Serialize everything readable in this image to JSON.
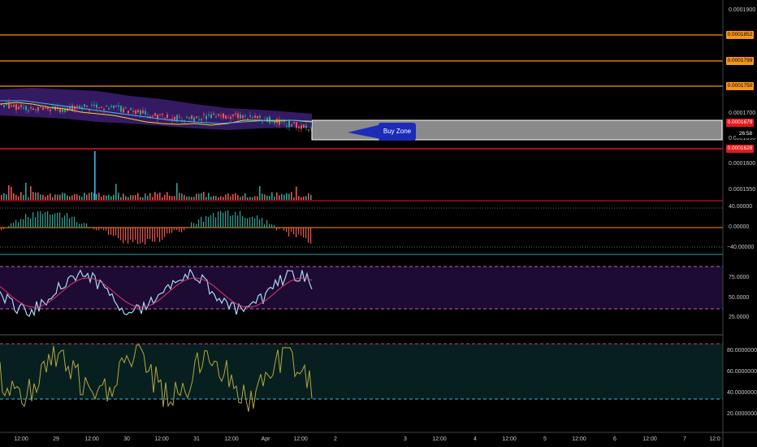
{
  "price_axis": {
    "labels": [
      "0.0001900",
      "0.0001700",
      "0.0001650",
      "0.0001600",
      "0.0001550"
    ],
    "tags": [
      {
        "value": "0.0001852",
        "color": "#f7941d"
      },
      {
        "value": "0.0001799",
        "color": "#f7941d"
      },
      {
        "value": "0.0001750",
        "color": "#f7941d"
      },
      {
        "value": "0.0001679",
        "color": "#e3191b"
      },
      {
        "value": "0.0001628",
        "color": "#e3191b"
      }
    ],
    "countdown": "26:58"
  },
  "annotation": {
    "label": "Buy Zone"
  },
  "indicator_axes": {
    "macd": [
      "40.00000",
      "0.00000",
      "−40.00000"
    ],
    "rsi": [
      "75.0000",
      "50.0000",
      "25.0000"
    ],
    "stoch": [
      "80.0000000",
      "60.0000000",
      "40.0000000",
      "20.0000000"
    ]
  },
  "time_axis": {
    "labels": [
      "12:00",
      "29",
      "12:00",
      "30",
      "12:00",
      "31",
      "12:00",
      "Apr",
      "12:00",
      "2",
      "3",
      "12:00",
      "4",
      "12:00",
      "5",
      "12:00",
      "6",
      "12:00",
      "7",
      "12:0"
    ]
  },
  "colors": {
    "up": "#26a69a",
    "down": "#ef5350",
    "orange": "#f7941d",
    "red": "#e3191b",
    "band": "#3a1d6e",
    "rsi_bg": "#1d0b33",
    "stoch_bg": "#07201f"
  },
  "chart_data": {
    "type": "line",
    "series": []
  }
}
